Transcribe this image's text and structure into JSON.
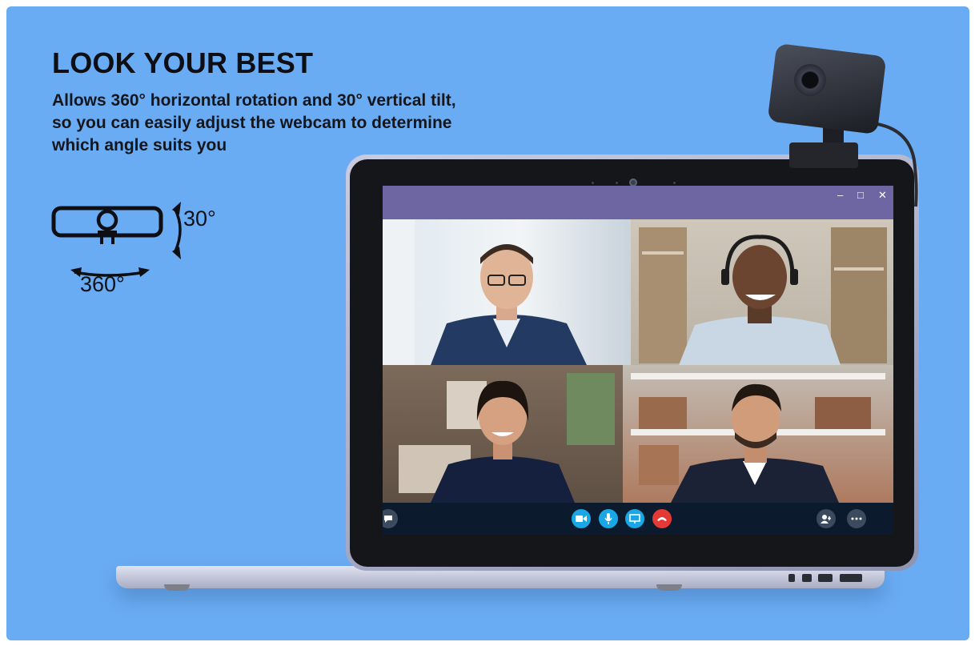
{
  "headline": "LOOK YOUR BEST",
  "subcopy": "Allows 360° horizontal rotation and 30° vertical tilt, so you can easily adjust the webcam to determine which angle suits you",
  "rotation": {
    "tilt_label": "30°",
    "pan_label": "360°"
  },
  "window_controls": {
    "minimize": "–",
    "maximize": "□",
    "close": "✕"
  },
  "colors": {
    "background": "#6aacf3",
    "titlebar": "#6e66a3",
    "call_bar": "#0c1a2e",
    "accent_blue": "#1aa7e6",
    "hangup_red": "#e53935"
  },
  "call_controls": [
    "chat-icon",
    "video-icon",
    "mic-icon",
    "screen-share-icon",
    "hang-up-icon",
    "add-people-icon",
    "more-icon"
  ]
}
